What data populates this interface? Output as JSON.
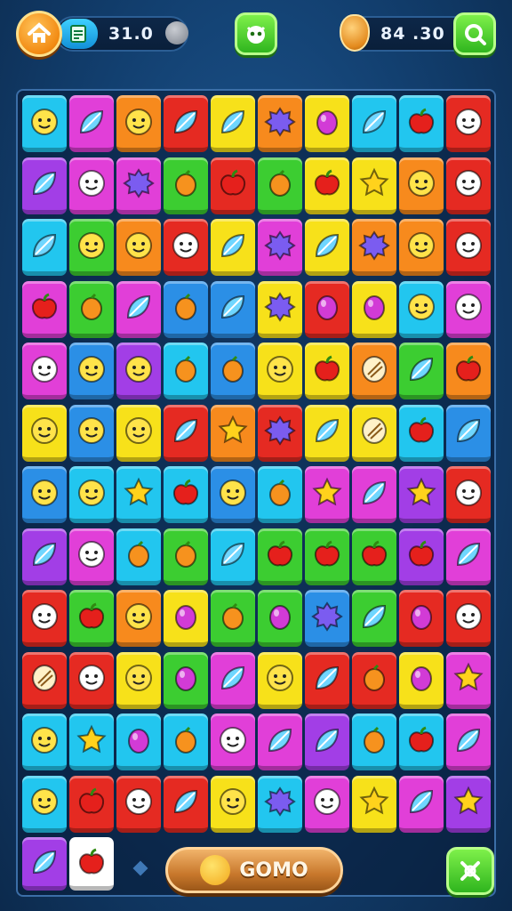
{
  "hud": {
    "left_counter": "31.0",
    "right_counter": "84 .30",
    "icons": [
      "home-icon",
      "notepad-icon",
      "smiley-icon",
      "green-face-icon",
      "coin-icon",
      "search-icon"
    ],
    "accent": "#2fb51e"
  },
  "board": {
    "rows": 13,
    "cols": 10,
    "palette": {
      "c": "#22c6ef",
      "m": "#e13fd8",
      "o": "#f78a1d",
      "r": "#e52a22",
      "y": "#f7e11a",
      "g": "#3ccd31",
      "p": "#a23ee6",
      "b": "#2b8fe6",
      "w": "#ffffff"
    },
    "tiles": [
      [
        "c:face",
        "m:leaf",
        "o:face",
        "r:leaf",
        "y:leaf",
        "o:burst",
        "y:berry",
        "c:leaf",
        "c:apple",
        "r:face"
      ],
      [
        "p:leaf",
        "m:face",
        "m:burst",
        "g:fruit",
        "r:apple",
        "g:fruit",
        "y:apple",
        "y:star",
        "o:face",
        "r:face"
      ],
      [
        "c:leaf",
        "g:face",
        "o:face",
        "r:face",
        "y:leaf",
        "m:burst",
        "y:leaf",
        "o:burst",
        "o:face",
        "r:face"
      ],
      [
        "m:apple",
        "g:fruit",
        "m:leaf",
        "b:fruit",
        "b:leaf",
        "y:burst",
        "r:berry",
        "y:berry",
        "c:face",
        "m:face"
      ],
      [
        "m:face",
        "b:face",
        "p:face",
        "c:fruit",
        "b:fruit",
        "y:face",
        "y:apple",
        "o:shell",
        "g:leaf",
        "o:apple"
      ],
      [
        "y:face",
        "b:face",
        "y:face",
        "r:leaf",
        "o:star",
        "r:burst",
        "y:leaf",
        "y:shell",
        "c:apple",
        "b:leaf"
      ],
      [
        "b:face",
        "c:face",
        "c:star",
        "c:apple",
        "b:face",
        "c:fruit",
        "m:star",
        "m:leaf",
        "p:star",
        "r:face"
      ],
      [
        "p:leaf",
        "m:face",
        "c:fruit",
        "g:fruit",
        "c:leaf",
        "g:apple",
        "g:apple",
        "g:apple",
        "p:apple",
        "m:leaf"
      ],
      [
        "r:face",
        "g:apple",
        "o:face",
        "y:berry",
        "g:fruit",
        "g:berry",
        "b:burst",
        "g:leaf",
        "r:berry",
        "r:face"
      ],
      [
        "r:shell",
        "r:face",
        "y:face",
        "g:berry",
        "m:leaf",
        "y:face",
        "r:leaf",
        "r:fruit",
        "y:berry",
        "m:star"
      ],
      [
        "c:face",
        "c:star",
        "c:berry",
        "c:fruit",
        "m:face",
        "m:leaf",
        "p:leaf",
        "c:fruit",
        "c:apple",
        "m:leaf"
      ],
      [
        "c:face",
        "r:apple",
        "r:face",
        "r:leaf",
        "y:face",
        "c:burst",
        "m:face",
        "y:star",
        "m:leaf",
        "p:star"
      ],
      [
        "p:leaf",
        "w:apple"
      ]
    ]
  },
  "bottom": {
    "go_label": "GOMO",
    "icons": [
      "coin-face-icon",
      "crossed-arrows-icon"
    ]
  }
}
